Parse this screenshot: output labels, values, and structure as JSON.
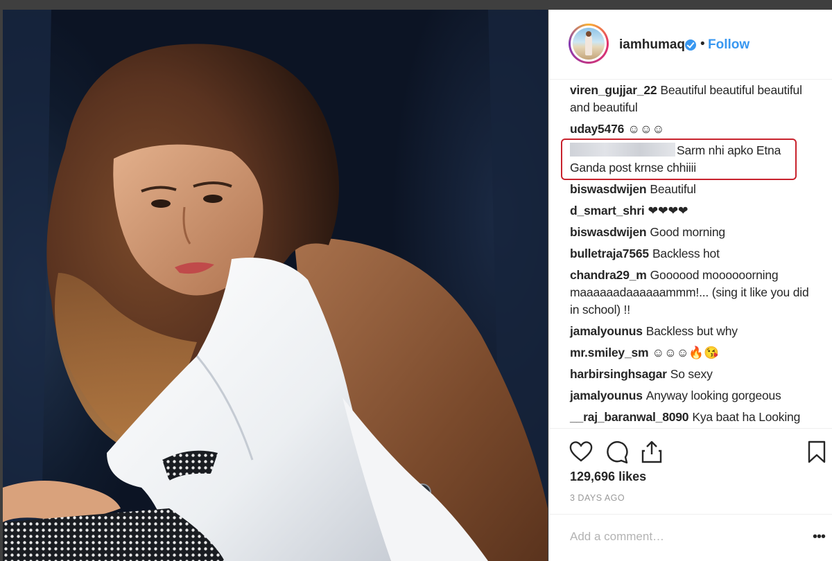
{
  "post": {
    "username": "iamhumaq",
    "follow_label": "Follow",
    "separator": "•",
    "likes": "129,696 likes",
    "date": "3 DAYS AGO",
    "add_comment_placeholder": "Add a comment…",
    "more_label": "•••"
  },
  "comments": [
    {
      "user": "viren_gujjar_22",
      "text": "Beautiful beautiful beautiful and beautiful"
    },
    {
      "user": "uday5476",
      "text": "☺☺☺"
    },
    {
      "user": "",
      "text": "Sarm nhi apko Etna Ganda post krnse chhiiii",
      "redacted_user": true,
      "highlighted": true
    },
    {
      "user": "biswasdwijen",
      "text": "Beautiful"
    },
    {
      "user": "d_smart_shri",
      "text": "❤❤❤❤"
    },
    {
      "user": "biswasdwijen",
      "text": "Good morning"
    },
    {
      "user": "bulletraja7565",
      "text": "Backless hot"
    },
    {
      "user": "chandra29_m",
      "text": "Goooood moooooorning maaaaaadaaaaaammm!... (sing it like you did in school) !!"
    },
    {
      "user": "jamalyounus",
      "text": "Backless but why"
    },
    {
      "user": "mr.smiley_sm",
      "text": "☺☺☺🔥😘"
    },
    {
      "user": "harbirsinghsagar",
      "text": "So sexy"
    },
    {
      "user": "jamalyounus",
      "text": "Anyway looking gorgeous"
    },
    {
      "user": "__raj_baranwal_8090",
      "text": "Kya baat ha Looking"
    }
  ],
  "icons": [
    "heart-icon",
    "comment-icon",
    "share-icon",
    "bookmark-icon",
    "verified-badge-icon"
  ],
  "colors": {
    "follow": "#3897f0",
    "highlight_border": "#c8222d",
    "text": "#262626",
    "muted": "#999999"
  }
}
